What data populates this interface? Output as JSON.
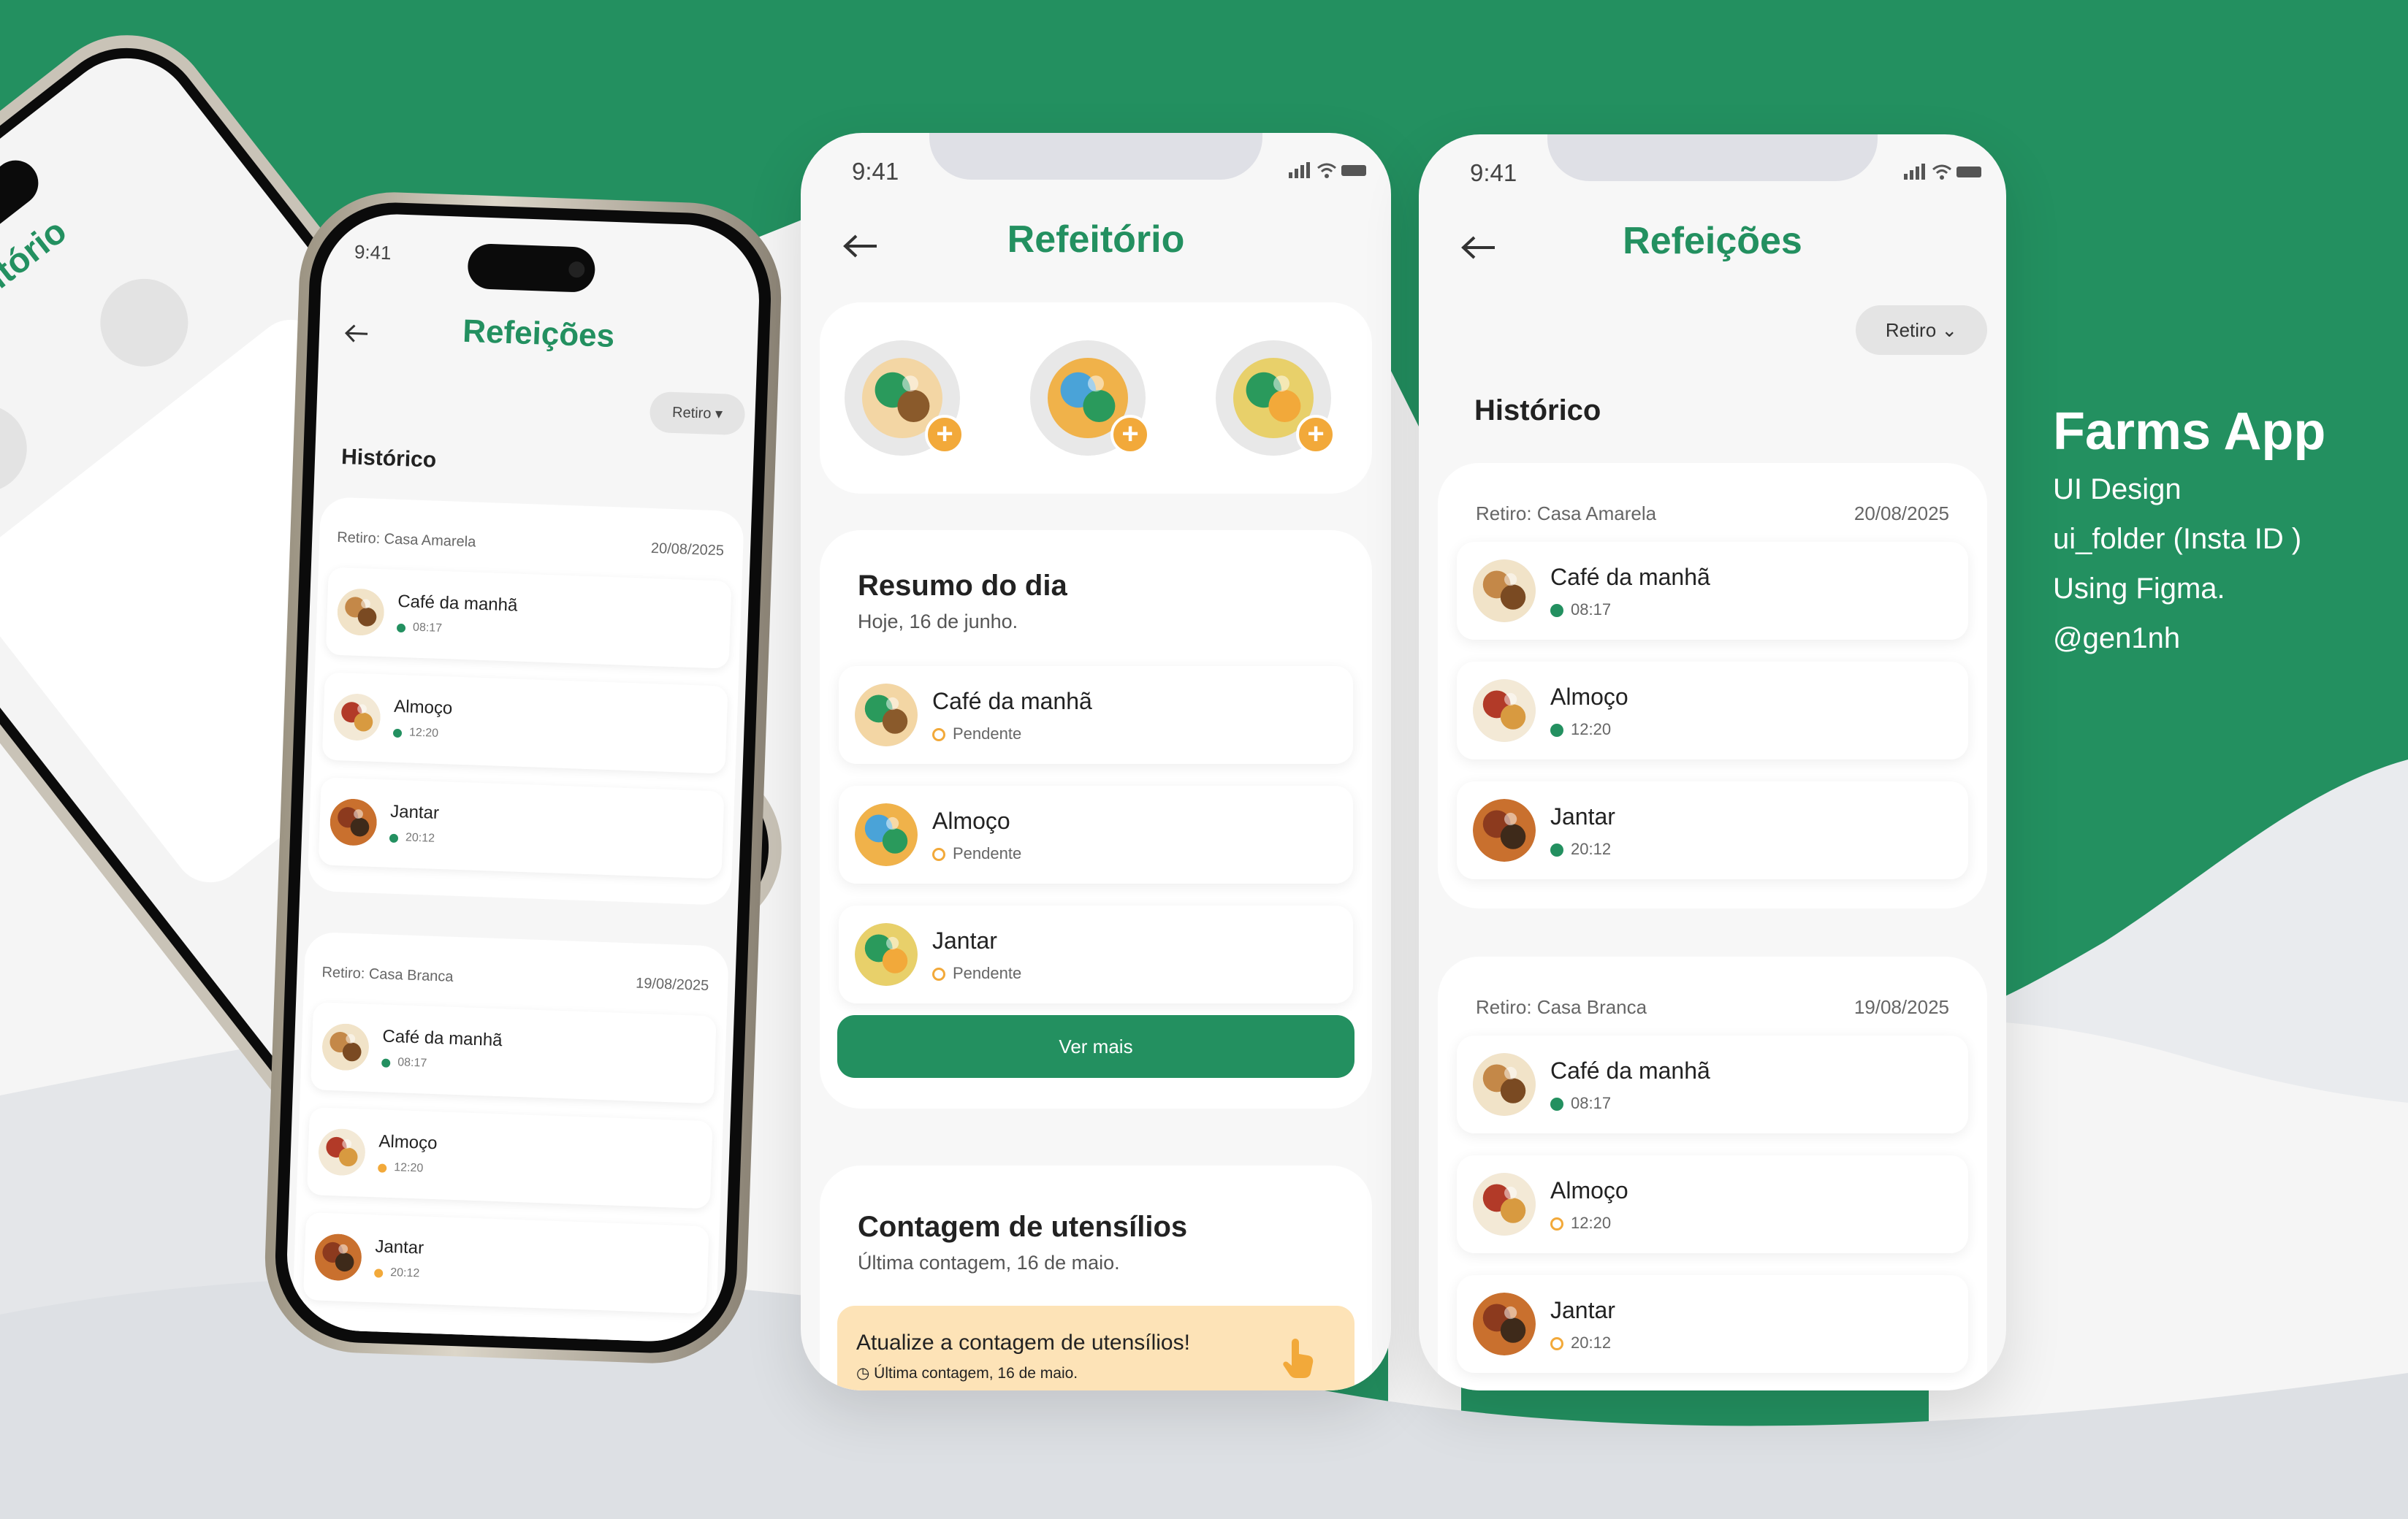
{
  "colors": {
    "brand_green": "#239060",
    "accent_orange": "#f2a93a",
    "bg_gray": "#e9ebee",
    "warning_bg": "#fde3b7"
  },
  "branding": {
    "title": "Farms App",
    "lines": [
      "UI Design",
      "ui_folder (Insta ID )",
      "Using Figma.",
      "@gen1nh"
    ]
  },
  "status_bar": {
    "time": "9:41"
  },
  "left_phone": {
    "title": "Refeições",
    "filter": "Retiro",
    "section": "Histórico",
    "groups": [
      {
        "place": "Retiro: Casa Amarela",
        "date": "20/08/2025",
        "items": [
          {
            "name": "Café da manhã",
            "time": "08:17"
          },
          {
            "name": "Almoço",
            "time": "12:20"
          },
          {
            "name": "Jantar",
            "time": "20:12"
          }
        ]
      },
      {
        "place": "Retiro: Casa Branca",
        "date": "19/08/2025",
        "items": [
          {
            "name": "Café da manhã",
            "time": "08:17"
          },
          {
            "name": "Almoço",
            "time": "12:20"
          },
          {
            "name": "Jantar",
            "time": "20:12"
          }
        ]
      }
    ]
  },
  "tilted_phone": {
    "title": "Refeitório"
  },
  "refeitorio": {
    "title": "Refeitório",
    "quick_add": [
      {
        "icon": "coffee-cup-icon"
      },
      {
        "icon": "lunch-plate-icon"
      },
      {
        "icon": "dinner-bowl-icon"
      }
    ],
    "summary": {
      "title": "Resumo do dia",
      "subtitle": "Hoje, 16 de junho.",
      "items": [
        {
          "name": "Café da manhã",
          "status": "Pendente"
        },
        {
          "name": "Almoço",
          "status": "Pendente"
        },
        {
          "name": "Jantar",
          "status": "Pendente"
        }
      ],
      "button": "Ver mais"
    },
    "utensils": {
      "title": "Contagem de utensílios",
      "subtitle": "Última contagem, 16 de maio.",
      "alert_title": "Atualize a contagem de utensílios!",
      "alert_sub": "Última contagem, 16 de maio."
    }
  },
  "refeicoes": {
    "title": "Refeições",
    "filter": "Retiro",
    "section": "Histórico",
    "groups": [
      {
        "place": "Retiro: Casa Amarela",
        "date": "20/08/2025",
        "items": [
          {
            "name": "Café da manhã",
            "time": "08:17",
            "status": "done"
          },
          {
            "name": "Almoço",
            "time": "12:20",
            "status": "done"
          },
          {
            "name": "Jantar",
            "time": "20:12",
            "status": "done"
          }
        ]
      },
      {
        "place": "Retiro: Casa Branca",
        "date": "19/08/2025",
        "items": [
          {
            "name": "Café da manhã",
            "time": "08:17",
            "status": "done"
          },
          {
            "name": "Almoço",
            "time": "12:20",
            "status": "pending"
          },
          {
            "name": "Jantar",
            "time": "20:12",
            "status": "pending"
          }
        ]
      }
    ]
  }
}
